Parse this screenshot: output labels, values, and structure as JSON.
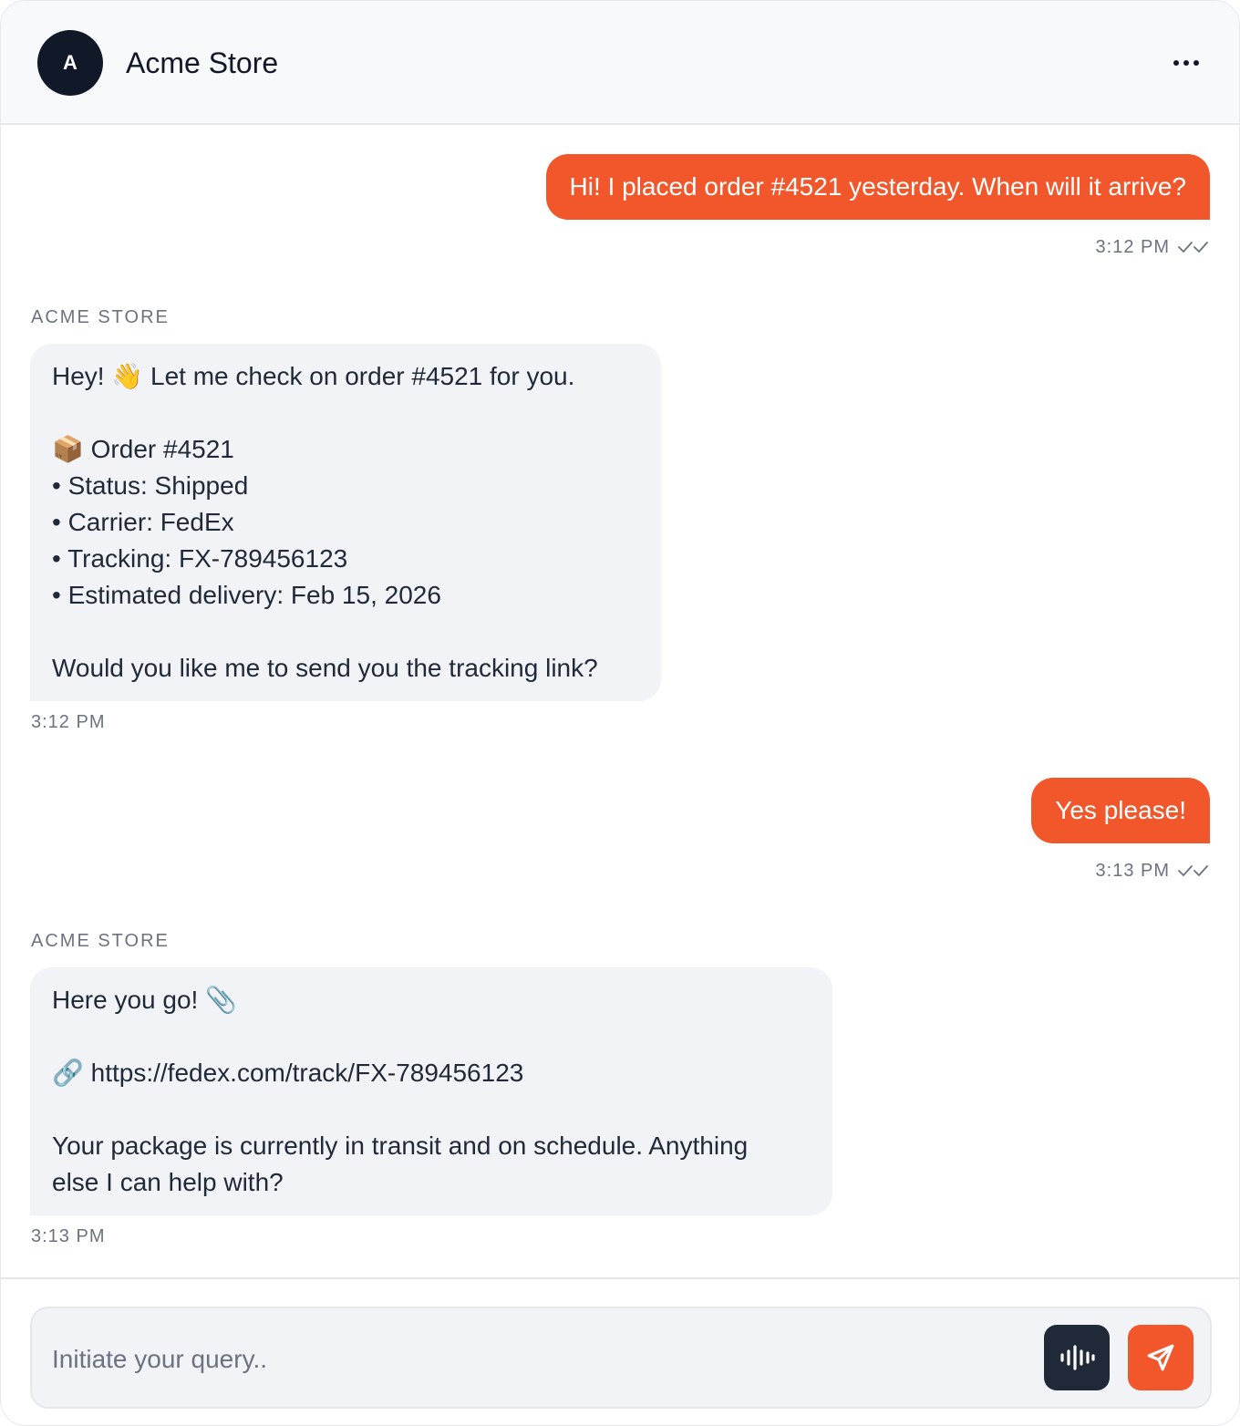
{
  "header": {
    "avatar_initial": "A",
    "title": "Acme Store",
    "more_icon": "ellipsis-icon"
  },
  "messages": [
    {
      "direction": "outgoing",
      "text": "Hi! I placed order #4521 yesterday. When will it arrive?",
      "time": "3:12 PM",
      "status_icon": "double-check-icon"
    },
    {
      "direction": "incoming",
      "sender": "ACME STORE",
      "text": "Hey! 👋 Let me check on order #4521 for you.\n\n📦 Order #4521\n• Status: Shipped\n• Carrier: FedEx\n• Tracking: FX-789456123\n• Estimated delivery: Feb 15, 2026\n\nWould you like me to send you the tracking link?",
      "time": "3:12 PM"
    },
    {
      "direction": "outgoing",
      "text": "Yes please!",
      "time": "3:13 PM",
      "status_icon": "double-check-icon"
    },
    {
      "direction": "incoming",
      "sender": "ACME STORE",
      "text": "Here you go! 📎\n\n🔗 https://fedex.com/track/FX-789456123\n\nYour package is currently in transit and on schedule. Anything\nelse I can help with?",
      "time": "3:13 PM"
    }
  ],
  "composer": {
    "placeholder": "Initiate your query..",
    "value": "",
    "voice_icon": "audio-waveform-icon",
    "send_icon": "send-icon"
  },
  "colors": {
    "accent": "#f2572c",
    "dark": "#111827",
    "incoming_bubble": "#f2f3f7"
  }
}
